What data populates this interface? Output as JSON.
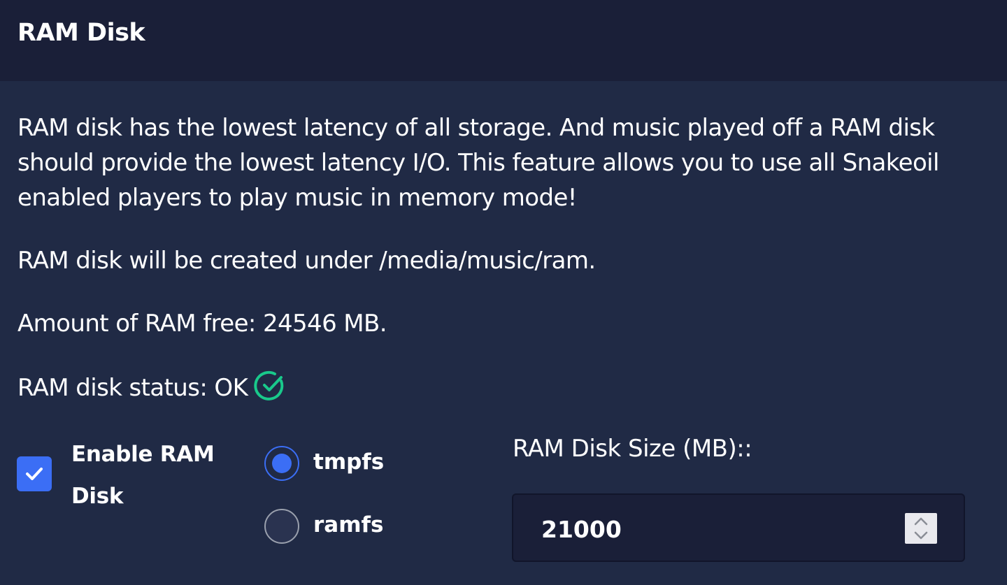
{
  "header": {
    "title": "RAM Disk"
  },
  "content": {
    "description": "RAM disk has the lowest latency of all storage. And music played off a RAM disk should provide the lowest latency I/O. This feature allows you to use all Snakeoil enabled players to play music in memory mode!",
    "path_text": "RAM disk will be created under /media/music/ram.",
    "free_text": "Amount of RAM free: 24546 MB.",
    "status_text": "RAM disk status: OK",
    "status_icon": "check-circle-icon",
    "status_color": "#19c98b"
  },
  "controls": {
    "enable_label": "Enable RAM Disk",
    "enable_checked": true,
    "fs_options": [
      {
        "label": "tmpfs",
        "selected": true
      },
      {
        "label": "ramfs",
        "selected": false
      }
    ],
    "size_label": "RAM Disk Size (MB)::",
    "size_value": "21000"
  },
  "colors": {
    "background": "#202a45",
    "header_background": "#1a1f38",
    "accent": "#3b6ef5",
    "ok_green": "#19c98b"
  }
}
